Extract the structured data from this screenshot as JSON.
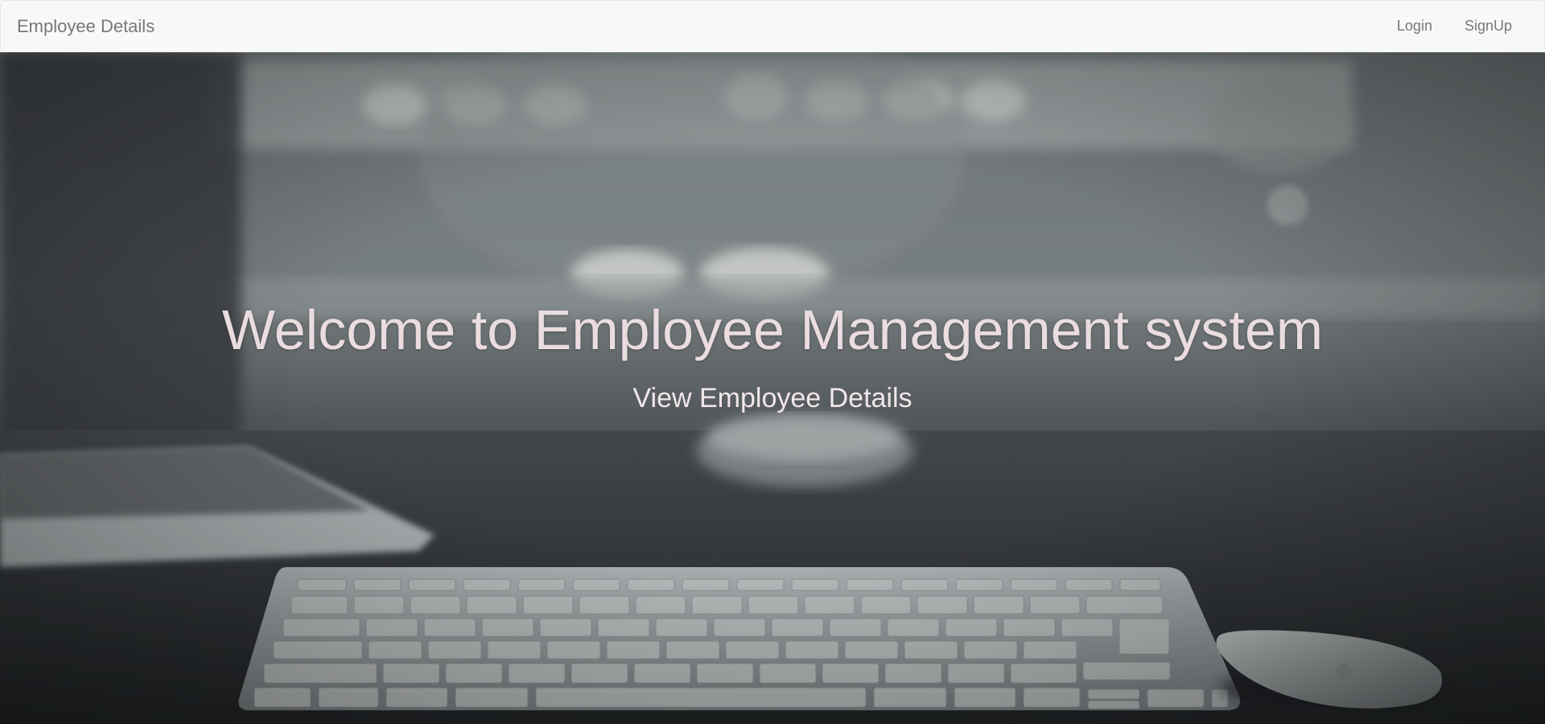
{
  "navbar": {
    "brand": "Employee Details",
    "links": [
      {
        "label": "Login"
      },
      {
        "label": "SignUp"
      }
    ]
  },
  "hero": {
    "title": "Welcome to Employee Management system",
    "link_label": "View Employee Details"
  },
  "colors": {
    "navbar_bg": "#f8f8f8",
    "nav_text": "#777777",
    "hero_text": "#eadcdf"
  }
}
